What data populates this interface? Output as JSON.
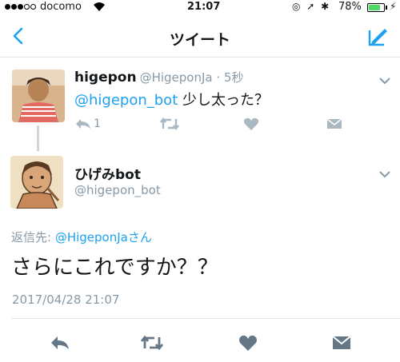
{
  "status_bar": {
    "carrier": "docomo",
    "time": "21:07",
    "battery": "78%",
    "battery_level": 0.78
  },
  "nav": {
    "title": "ツイート"
  },
  "parent_tweet": {
    "display_name": "higepon",
    "handle_time": "@HigeponJa · 5秒",
    "mention": "@higepon_bot",
    "text": " 少し太った？",
    "reply_count": "1"
  },
  "main_tweet": {
    "display_name": "ひげみbot",
    "handle": "@higepon_bot",
    "reply_to_label": "返信先: ",
    "reply_to_handle": "@HigeponJaさん",
    "text": "さらにこれですか？？",
    "timestamp": "2017/04/28 21:07"
  },
  "colors": {
    "accent": "#1da1f2",
    "icon_gray": "#8899a6",
    "action_dark": "#657786",
    "battery_green": "#4cd964"
  },
  "icons": [
    "back-chevron",
    "compose-tweet",
    "reply",
    "retweet",
    "like-heart",
    "direct-message",
    "caret-down"
  ]
}
